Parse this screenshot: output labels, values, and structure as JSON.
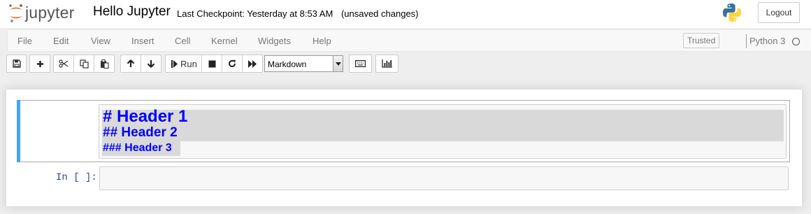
{
  "header": {
    "logo_text": "jupyter",
    "notebook_title": "Hello Jupyter",
    "checkpoint_text": "Last Checkpoint: Yesterday at 8:53 AM",
    "autosave_status": "(unsaved changes)",
    "logout_label": "Logout",
    "kernel_logo_icon": "python-logo-icon",
    "colors": {
      "logo_orange": "#f37726",
      "logo_gray": "#616161",
      "python_blue": "#3671a1",
      "python_yellow": "#ffd43b"
    }
  },
  "menubar": {
    "items": [
      {
        "label": "File"
      },
      {
        "label": "Edit"
      },
      {
        "label": "View"
      },
      {
        "label": "Insert"
      },
      {
        "label": "Cell"
      },
      {
        "label": "Kernel"
      },
      {
        "label": "Widgets"
      },
      {
        "label": "Help"
      }
    ],
    "trusted_label": "Trusted",
    "kernel_name": "Python 3",
    "kernel_status_icon": "kernel-idle-circle-icon"
  },
  "toolbar": {
    "buttons": [
      {
        "icon": "save-icon"
      },
      {
        "icon": "plus-icon"
      },
      {
        "icon": "cut-icon"
      },
      {
        "icon": "copy-icon"
      },
      {
        "icon": "paste-icon"
      },
      {
        "icon": "arrow-up-icon"
      },
      {
        "icon": "arrow-down-icon"
      },
      {
        "icon": "step-forward-icon"
      },
      {
        "icon": "stop-icon"
      },
      {
        "icon": "restart-icon"
      },
      {
        "icon": "fast-forward-icon"
      },
      {
        "icon": "keyboard-icon"
      },
      {
        "icon": "bar-chart-icon"
      }
    ],
    "run_label": "Run",
    "cell_type": "Markdown"
  },
  "cells": {
    "markdown_lines": [
      "# Header 1",
      "## Header 2",
      "### Header 3"
    ],
    "selected_border_color": "#42a5f5",
    "heading_color": "#0000ff",
    "code_prompt": "In [ ]:"
  }
}
